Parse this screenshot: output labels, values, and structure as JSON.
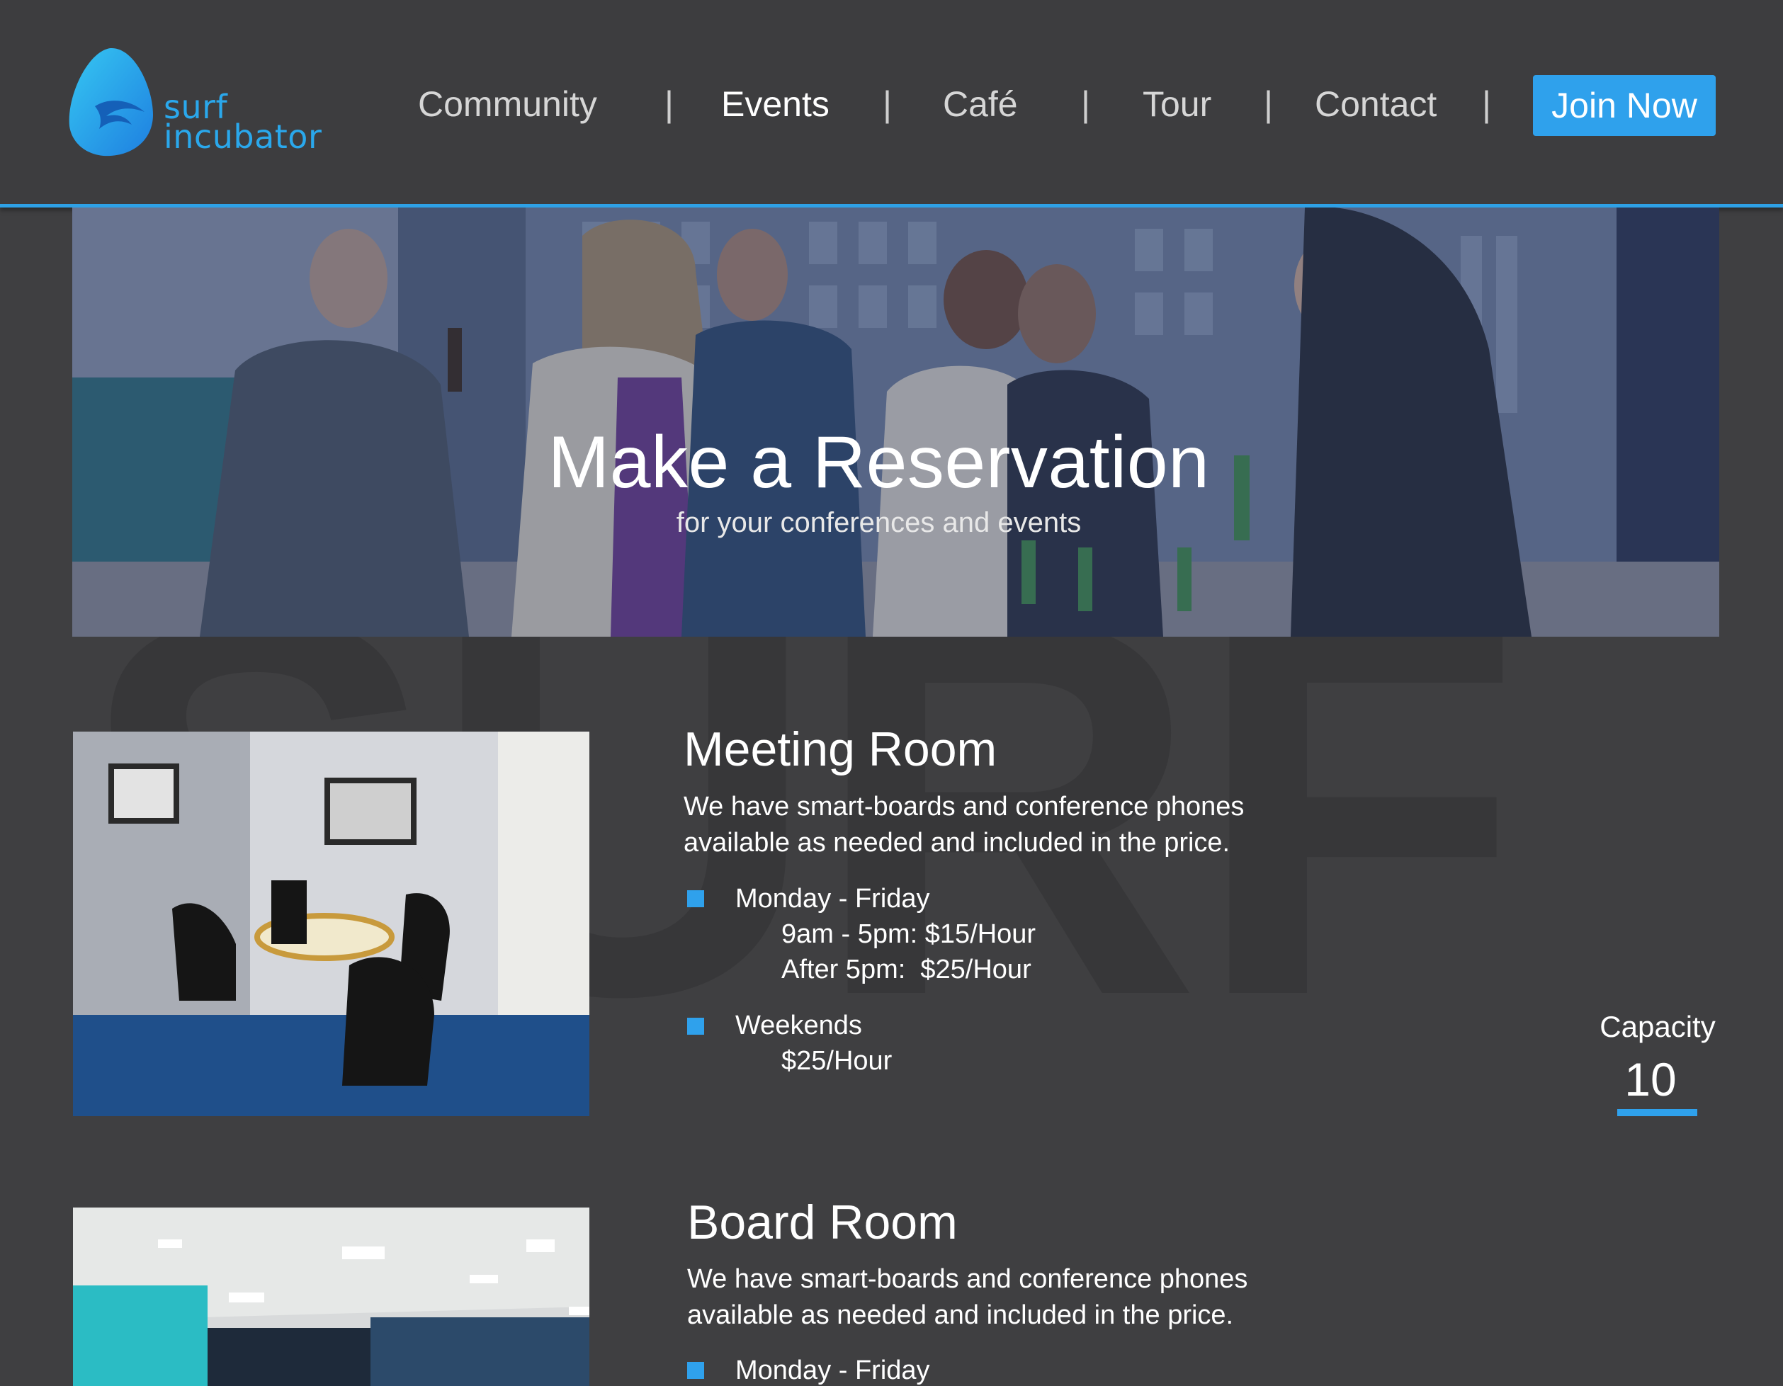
{
  "brand": {
    "line1": "surf",
    "line2": "incubator",
    "accent_color": "#2fa1ec"
  },
  "nav": {
    "items": [
      {
        "label": "Community",
        "active": false
      },
      {
        "label": "Events",
        "active": true
      },
      {
        "label": "Café",
        "active": false
      },
      {
        "label": "Tour",
        "active": false
      },
      {
        "label": "Contact",
        "active": false
      }
    ],
    "separator": "|",
    "cta_label": "Join Now"
  },
  "hero": {
    "title": "Make a Reservation",
    "subtitle": "for your conferences and events"
  },
  "watermark": "SURF",
  "rooms": [
    {
      "title": "Meeting Room",
      "description_line1": "We have smart-boards and conference phones",
      "description_line2": "available as needed and included in the price.",
      "schedules": [
        {
          "label": "Monday - Friday",
          "lines": [
            "9am - 5pm: $15/Hour",
            "After 5pm:  $25/Hour"
          ]
        },
        {
          "label": "Weekends",
          "lines": [
            "$25/Hour"
          ]
        }
      ],
      "capacity_label": "Capacity",
      "capacity_value": "10"
    },
    {
      "title": "Board Room",
      "description_line1": "We have smart-boards and conference phones",
      "description_line2": "available as needed and included in the price.",
      "schedules": [
        {
          "label": "Monday - Friday",
          "lines": []
        }
      ]
    }
  ]
}
